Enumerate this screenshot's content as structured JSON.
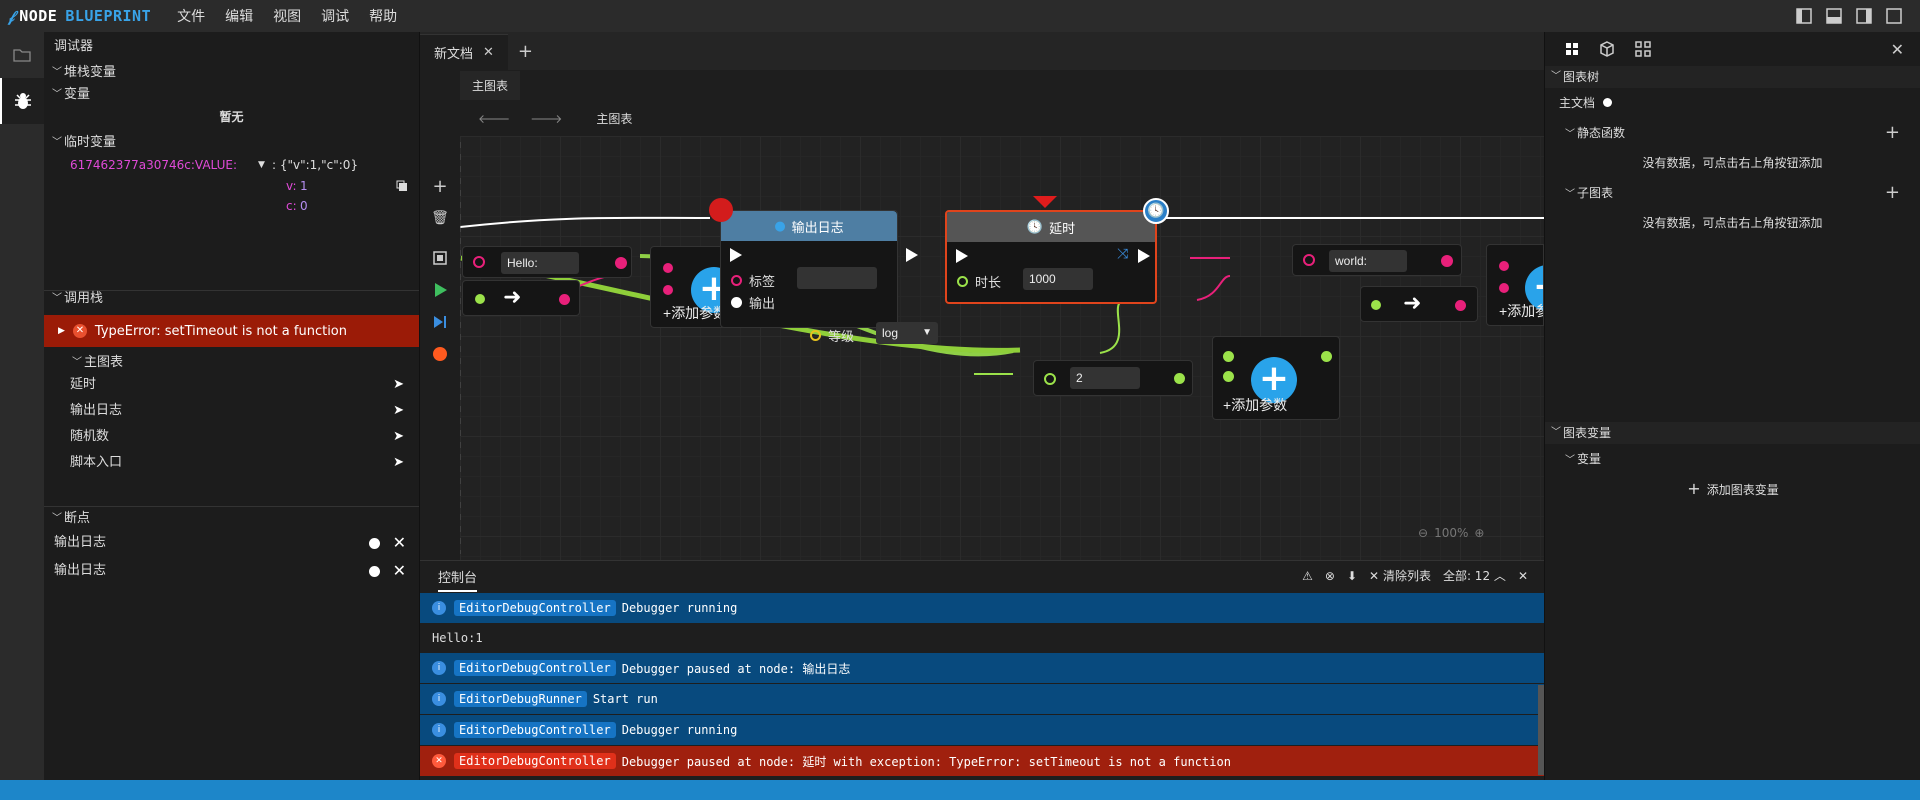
{
  "app": {
    "logo_part1": "NODE",
    "logo_part2": "BLUEPRINT"
  },
  "menu": [
    "文件",
    "编辑",
    "视图",
    "调试",
    "帮助"
  ],
  "debugger": {
    "title": "调试器",
    "stack_vars": "堆栈变量",
    "vars": "变量",
    "vars_empty": "暂无",
    "temp_vars": "临时变量",
    "temp_var_key": "617462377a30746c:VALUE:",
    "temp_var_value": ": {\"v\":1,\"c\":0}",
    "temp_var_v_key": "v:",
    "temp_var_v_val": "1",
    "temp_var_c_key": "c:",
    "temp_var_c_val": "0",
    "call_stack": "调用栈",
    "error": "TypeError: setTimeout is not a function",
    "main_graph": "主图表",
    "stack_items": [
      "延时",
      "输出日志",
      "随机数",
      "脚本入口"
    ],
    "breakpoints": "断点",
    "breakpoint_items": [
      "输出日志",
      "输出日志"
    ]
  },
  "editor": {
    "tab": "新文档",
    "subtab": "主图表",
    "breadcrumb": "主图表",
    "zoom": "100%"
  },
  "nodes": {
    "log_title": "输出日志",
    "log_label": "标签",
    "log_output": "输出",
    "log_level": "等级",
    "log_level_value": "log",
    "delay_title": "延时",
    "delay_duration": "时长",
    "delay_value": "1000",
    "str1": "Hello:",
    "str2": "world:",
    "num": "2",
    "add_param": "添加参数"
  },
  "rpanel": {
    "graph_tree": "图表树",
    "main_doc": "主文档",
    "static_funcs": "静态函数",
    "no_data": "没有数据，可点击右上角按钮添加",
    "sub_graphs": "子图表",
    "graph_vars": "图表变量",
    "vars": "变量",
    "add_var": "添加图表变量"
  },
  "console": {
    "tab": "控制台",
    "clear": "清除列表",
    "all": "全部: 12",
    "logs": [
      {
        "type": "info",
        "tag": "EditorDebugController",
        "msg": "Debugger running"
      },
      {
        "type": "plain",
        "tag": "",
        "msg": "Hello:1"
      },
      {
        "type": "info",
        "tag": "EditorDebugController",
        "msg": "Debugger paused at node: 输出日志"
      },
      {
        "type": "info",
        "tag": "EditorDebugRunner",
        "msg": "Start run"
      },
      {
        "type": "info",
        "tag": "EditorDebugController",
        "msg": "Debugger running"
      },
      {
        "type": "err",
        "tag": "EditorDebugController",
        "msg": "Debugger paused at node: 延时 with exception: TypeError: setTimeout is not a function"
      }
    ]
  },
  "colors": {
    "accent": "#1d86c9",
    "error": "#9b1b07",
    "info": "#084a7e",
    "exec_green": "#9be24a",
    "pin_pink": "#e8207a"
  }
}
